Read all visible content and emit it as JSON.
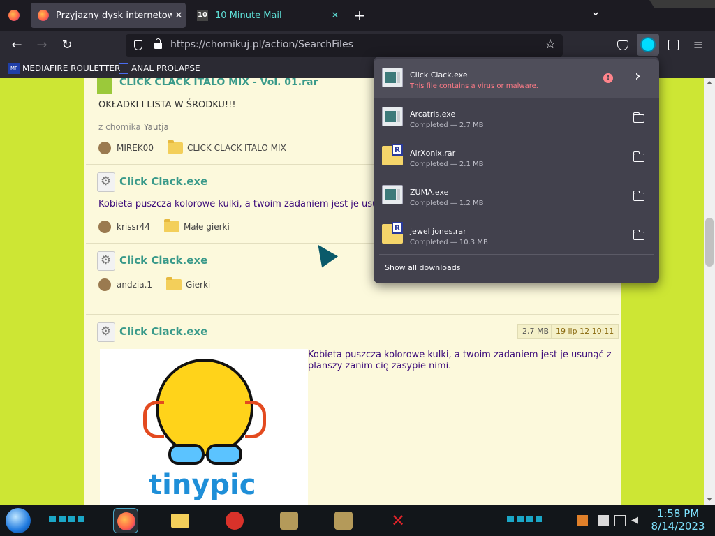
{
  "tabs": [
    {
      "title": "Przyjazny dysk internetowy - Chomikuj.pl",
      "close": "✕",
      "icon": "firefox-logo"
    },
    {
      "title": "10 Minute Mail",
      "close": "✕",
      "favicon_text": "10"
    }
  ],
  "tabbar": {
    "new_tab": "+",
    "list_tabs": "⌄"
  },
  "nav": {
    "url": "https://chomikuj.pl/action/SearchFiles",
    "back": "←",
    "forward": "→",
    "reload": "↻",
    "bookmark_star": "☆",
    "menu": "≡"
  },
  "bookmarks": [
    {
      "label": "MEDIAFIRE ROULETTER",
      "icon_text": "MF"
    },
    {
      "label": "ANAL PROLAPSE"
    }
  ],
  "results": [
    {
      "title": "CLICK CLACK ITALO MIX - Vol. 01.rar",
      "desc": "OKŁADKI I LISTA W ŚRODKU!!!",
      "from_label": "z chomika",
      "from_user": "Yautja",
      "user": "MIREK00",
      "folder": "CLICK CLACK ITALO MIX"
    },
    {
      "title": "Click Clack.exe",
      "desc": "Kobieta puszcza kolorowe kulki, a twoim zadaniem jest je usu",
      "user": "krissr44",
      "folder": "Małe gierki"
    },
    {
      "title": "Click Clack.exe",
      "user": "andzia.1",
      "folder": "Gierki"
    },
    {
      "title": "Click Clack.exe",
      "size": "2,7 MB",
      "date": "19 lip 12 10:11",
      "desc1": "Kobieta puszcza kolorowe kulki, a twoim zadaniem jest je usunąć z",
      "desc2": "planszy zanim cię zasypie nimi.",
      "image_text": "tinypic"
    }
  ],
  "downloads": {
    "items": [
      {
        "name": "Click Clack.exe",
        "status": "This file contains a virus or malware.",
        "type": "exe",
        "error": true
      },
      {
        "name": "Arcatris.exe",
        "status": "Completed — 2.7 MB",
        "type": "exe"
      },
      {
        "name": "AirXonix.rar",
        "status": "Completed — 2.1 MB",
        "type": "rar"
      },
      {
        "name": "ZUMA.exe",
        "status": "Completed — 1.2 MB",
        "type": "exe"
      },
      {
        "name": "jewel jones.rar",
        "status": "Completed — 10.3 MB",
        "type": "rar"
      }
    ],
    "show_all": "Show all downloads",
    "error_mark": "!",
    "arrow": "›"
  },
  "clock": {
    "time": "1:58 PM",
    "date": "8/14/2023"
  },
  "colors": {
    "accent": "#3a9a8a",
    "desc": "#3b0a7a",
    "page_bg": "#fcf9dc",
    "side_bg": "#cde634",
    "error": "#ff7b87"
  }
}
